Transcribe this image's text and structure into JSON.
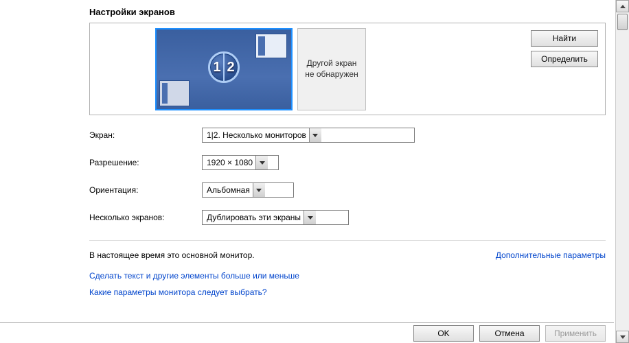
{
  "title": "Настройки экранов",
  "preview": {
    "badge_left": "1",
    "badge_right": "2",
    "other_line1": "Другой экран",
    "other_line2": "не обнаружен",
    "find_button": "Найти",
    "identify_button": "Определить"
  },
  "form": {
    "display_label": "Экран:",
    "display_value": "1|2. Несколько мониторов",
    "resolution_label": "Разрешение:",
    "resolution_value": "1920 × 1080",
    "orientation_label": "Ориентация:",
    "orientation_value": "Альбомная",
    "multi_label": "Несколько экранов:",
    "multi_value": "Дублировать эти экраны"
  },
  "status": {
    "primary_text": "В настоящее время это основной монитор.",
    "advanced_link": "Дополнительные параметры"
  },
  "links": {
    "text_size": "Сделать текст и другие элементы больше или меньше",
    "which_settings": "Какие параметры монитора следует выбрать?"
  },
  "buttons": {
    "ok": "OK",
    "cancel": "Отмена",
    "apply": "Применить"
  }
}
